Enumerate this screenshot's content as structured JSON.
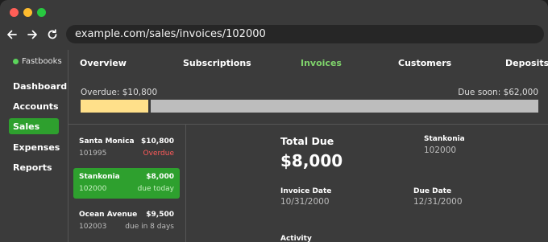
{
  "browser": {
    "url": "example.com/sales/invoices/102000"
  },
  "sidebar": {
    "brand": "Fastbooks",
    "items": [
      {
        "label": "Dashboard",
        "active": false
      },
      {
        "label": "Accounts",
        "active": false
      },
      {
        "label": "Sales",
        "active": true
      },
      {
        "label": "Expenses",
        "active": false
      },
      {
        "label": "Reports",
        "active": false
      }
    ]
  },
  "tabs": [
    {
      "label": "Overview",
      "active": false
    },
    {
      "label": "Subscriptions",
      "active": false
    },
    {
      "label": "Invoices",
      "active": true
    },
    {
      "label": "Customers",
      "active": false
    },
    {
      "label": "Deposits",
      "active": false
    }
  ],
  "summary": {
    "overdue_label": "Overdue: $10,800",
    "due_soon_label": "Due soon: $62,000",
    "overdue_amount": 10800,
    "due_soon_amount": 62000,
    "overdue_color": "#ffe08a",
    "due_soon_color": "#bdbdbd"
  },
  "invoices": [
    {
      "name": "Santa Monica",
      "amount": "$10,800",
      "id": "101995",
      "status": "Overdue",
      "active": false
    },
    {
      "name": "Stankonia",
      "amount": "$8,000",
      "id": "102000",
      "status": "due today",
      "active": true
    },
    {
      "name": "Ocean Avenue",
      "amount": "$9,500",
      "id": "102003",
      "status": "due in 8 days",
      "active": false
    }
  ],
  "detail": {
    "total_due_label": "Total Due",
    "total_due": "$8,000",
    "customer": "Stankonia",
    "customer_id": "102000",
    "invoice_date_label": "Invoice Date",
    "invoice_date": "10/31/2000",
    "due_date_label": "Due Date",
    "due_date": "12/31/2000",
    "activity_label": "Activity"
  },
  "colors": {
    "accent": "#2ea02e",
    "active_tab": "#7fd36b",
    "overdue_text": "#ff5a5a"
  }
}
